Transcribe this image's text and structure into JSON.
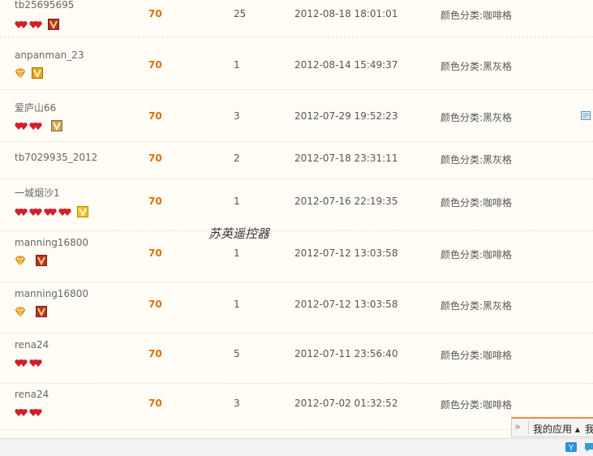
{
  "rows": [
    {
      "buyer": "tb25695695",
      "credit": "hearts",
      "count": 4,
      "vip": "red",
      "price": "70",
      "qty": "25",
      "time": "2012-08-18 18:01:01",
      "sku": "颜色分类:咖啡格"
    },
    {
      "buyer": "anpanman_23",
      "credit": "diamond",
      "count": 1,
      "vip": "gold",
      "price": "70",
      "qty": "1",
      "time": "2012-08-14 15:49:37",
      "sku": "颜色分类:黑灰格"
    },
    {
      "buyer": "爱庐山66",
      "credit": "hearts",
      "count": 2,
      "vip": "tan",
      "price": "70",
      "qty": "3",
      "time": "2012-07-29 19:52:23",
      "sku": "颜色分类:黑灰格"
    },
    {
      "buyer": "tb7029935_2012",
      "credit": "none",
      "count": 0,
      "vip": "none",
      "price": "70",
      "qty": "2",
      "time": "2012-07-18 23:31:11",
      "sku": "颜色分类:黑灰格"
    },
    {
      "buyer": "一城烟沙1",
      "credit": "hearts",
      "count": 4,
      "vip": "gold",
      "price": "70",
      "qty": "1",
      "time": "2012-07-16 22:19:35",
      "sku": "颜色分类:咖啡格"
    },
    {
      "buyer": "manning16800",
      "credit": "diamond",
      "count": 1,
      "vip": "red",
      "price": "70",
      "qty": "1",
      "time": "2012-07-12 13:03:58",
      "sku": "颜色分类:咖啡格"
    },
    {
      "buyer": "manning16800",
      "credit": "diamond",
      "count": 1,
      "vip": "red",
      "price": "70",
      "qty": "1",
      "time": "2012-07-12 13:03:58",
      "sku": "颜色分类:黑灰格"
    },
    {
      "buyer": "rena24",
      "credit": "hearts",
      "count": 2,
      "vip": "none",
      "price": "70",
      "qty": "5",
      "time": "2012-07-11 23:56:40",
      "sku": "颜色分类:咖啡格"
    },
    {
      "buyer": "rena24",
      "credit": "hearts",
      "count": 2,
      "vip": "none",
      "price": "70",
      "qty": "3",
      "time": "2012-07-02 01:32:52",
      "sku": "颜色分类:咖啡格"
    }
  ],
  "watermark": "苏英遥控器",
  "app_bar": {
    "label": "我的应用 ▴",
    "label2": "我",
    "toggle_icon": "double-chevron-right-icon"
  },
  "colors": {
    "price": "#e36c09",
    "background": "#fffdf5",
    "divider": "#e9e3cf",
    "accent_border": "#f2873d"
  }
}
